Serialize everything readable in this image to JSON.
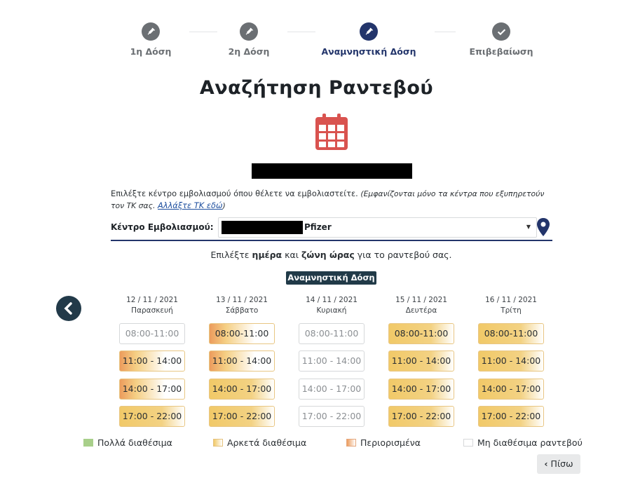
{
  "stepper": {
    "steps": [
      {
        "label": "1η Δόση",
        "icon": "syringe-icon"
      },
      {
        "label": "2η Δόση",
        "icon": "syringe-icon"
      },
      {
        "label": "Αναμνηστική Δόση",
        "icon": "syringe-icon"
      },
      {
        "label": "Επιβεβαίωση",
        "icon": "check-icon"
      }
    ],
    "active_index": 2
  },
  "page_title": "Αναζήτηση Ραντεβού",
  "info": {
    "text": "Επιλέξτε κέντρο εμβολιασμού όπου θέλετε να εμβολιαστείτε.",
    "note_before": "(Εμφανίζονται μόνο τα κέντρα που εξυπηρετούν τον ΤΚ σας.",
    "link": "Αλλάξτε ΤΚ εδώ",
    "note_after": ")"
  },
  "center": {
    "label": "Κέντρο Εμβολιασμού:",
    "selected_value": "Pfizer"
  },
  "prompt": {
    "before": "Επιλέξτε",
    "bold1": "ημέρα",
    "middle": "και",
    "bold2": "ζώνη ώρας",
    "after": "για το ραντεβού σας."
  },
  "dose_badge": "Αναμνηστική Δόση",
  "days": [
    {
      "date": "12 / 11 / 2021",
      "name": "Παρασκευή",
      "slots": [
        {
          "time": "08:00-11:00",
          "status": "none"
        },
        {
          "time": "11:00 - 14:00",
          "status": "limited"
        },
        {
          "time": "14:00 - 17:00",
          "status": "limited"
        },
        {
          "time": "17:00 - 22:00",
          "status": "some"
        }
      ]
    },
    {
      "date": "13 / 11 / 2021",
      "name": "Σάββατο",
      "slots": [
        {
          "time": "08:00-11:00",
          "status": "limited"
        },
        {
          "time": "11:00 - 14:00",
          "status": "limited"
        },
        {
          "time": "14:00 - 17:00",
          "status": "some"
        },
        {
          "time": "17:00 - 22:00",
          "status": "some"
        }
      ]
    },
    {
      "date": "14 / 11 / 2021",
      "name": "Κυριακή",
      "slots": [
        {
          "time": "08:00-11:00",
          "status": "none"
        },
        {
          "time": "11:00 - 14:00",
          "status": "none"
        },
        {
          "time": "14:00 - 17:00",
          "status": "none"
        },
        {
          "time": "17:00 - 22:00",
          "status": "none"
        }
      ]
    },
    {
      "date": "15 / 11 / 2021",
      "name": "Δευτέρα",
      "slots": [
        {
          "time": "08:00-11:00",
          "status": "some"
        },
        {
          "time": "11:00 - 14:00",
          "status": "some"
        },
        {
          "time": "14:00 - 17:00",
          "status": "some"
        },
        {
          "time": "17:00 - 22:00",
          "status": "some"
        }
      ]
    },
    {
      "date": "16 / 11 / 2021",
      "name": "Τρίτη",
      "slots": [
        {
          "time": "08:00-11:00",
          "status": "some"
        },
        {
          "time": "11:00 - 14:00",
          "status": "some"
        },
        {
          "time": "14:00 - 17:00",
          "status": "some"
        },
        {
          "time": "17:00 - 22:00",
          "status": "some"
        }
      ]
    }
  ],
  "legend": [
    {
      "key": "many",
      "label": "Πολλά διαθέσιμα"
    },
    {
      "key": "some",
      "label": "Αρκετά διαθέσιμα"
    },
    {
      "key": "limited",
      "label": "Περιορισμένα"
    },
    {
      "key": "none",
      "label": "Μη διαθέσιμα ραντεβού"
    }
  ],
  "back_button": "Πίσω",
  "colors": {
    "primary": "#23356b",
    "dark_button": "#223a49",
    "calendar_icon": "#d9534f",
    "many": "#a8cf8a",
    "some": "#f1c968",
    "limited": "#ec9c5d"
  }
}
